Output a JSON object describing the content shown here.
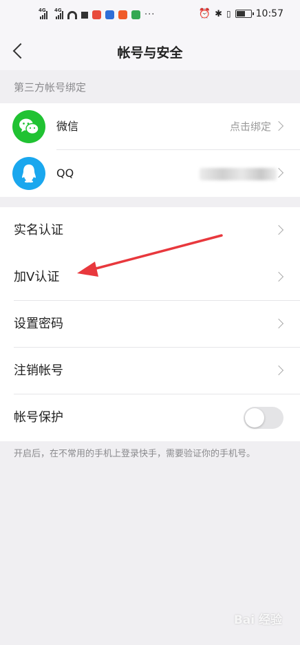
{
  "status_bar": {
    "network_a": "4G",
    "network_b": "4G",
    "time": "10:57",
    "overflow": "···",
    "app_icon_colors": [
      "#e84b3c",
      "#2f6fd8",
      "#f05a28",
      "#34a853"
    ]
  },
  "header": {
    "title": "帐号与安全"
  },
  "third_party": {
    "section_label": "第三方帐号绑定",
    "items": [
      {
        "label": "微信",
        "hint": "点击绑定",
        "icon": "wechat-icon",
        "color": "#20c232"
      },
      {
        "label": "QQ",
        "hint": "",
        "icon": "qq-icon",
        "color": "#1aa7ee"
      }
    ]
  },
  "settings": {
    "items": [
      {
        "label": "实名认证"
      },
      {
        "label": "加V认证"
      },
      {
        "label": "设置密码"
      },
      {
        "label": "注销帐号"
      }
    ],
    "protection": {
      "label": "帐号保护",
      "enabled": false
    }
  },
  "footnote": "开启后，在不常用的手机上登录快手，需要验证你的手机号。",
  "annotation_color": "#e8383d",
  "watermark": "Bai 经验"
}
